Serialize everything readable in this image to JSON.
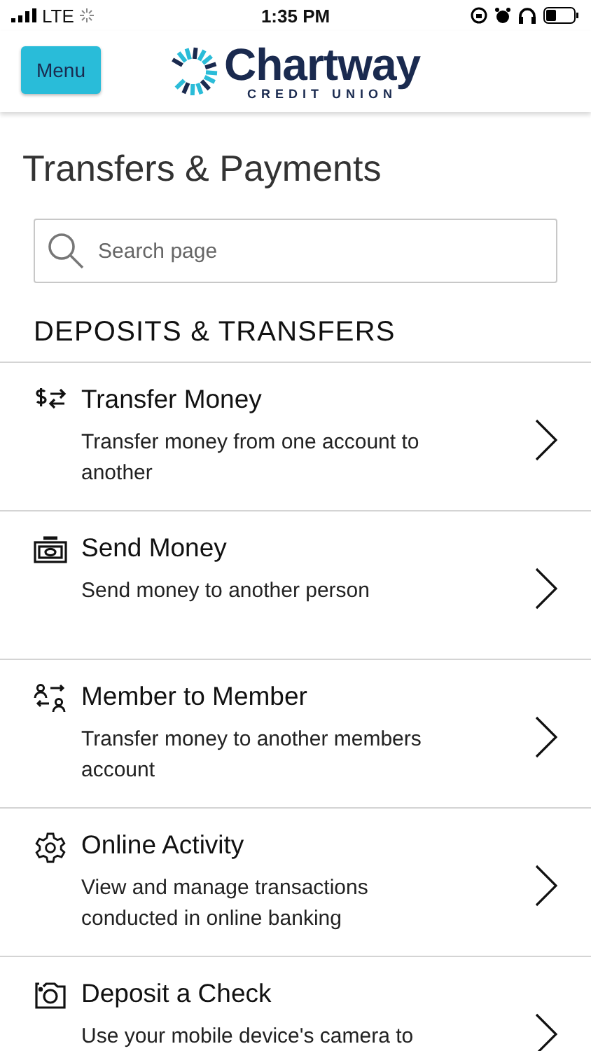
{
  "status_bar": {
    "carrier": "LTE",
    "time": "1:35 PM"
  },
  "header": {
    "menu_button": "Menu",
    "logo": {
      "name": "Chartway",
      "tagline": "CREDIT UNION"
    }
  },
  "page_title": "Transfers & Payments",
  "search": {
    "placeholder": "Search page"
  },
  "section_heading": "DEPOSITS & TRANSFERS",
  "items": [
    {
      "title": "Transfer Money",
      "description": "Transfer money from one account to another"
    },
    {
      "title": "Send Money",
      "description": "Send money to another person"
    },
    {
      "title": "Member to Member",
      "description": "Transfer money to another members account"
    },
    {
      "title": "Online Activity",
      "description": "View and manage transactions conducted in online banking"
    },
    {
      "title": "Deposit a Check",
      "description": "Use your mobile device's camera to"
    }
  ]
}
